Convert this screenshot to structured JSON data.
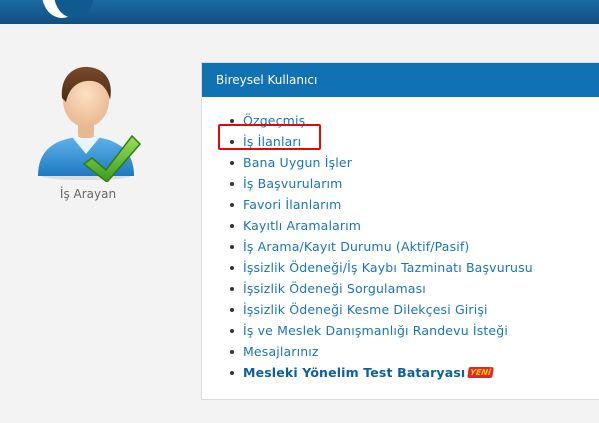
{
  "header": {
    "logo_icon": "site-logo-icon"
  },
  "profile": {
    "avatar_icon": "user-checkmark-icon",
    "label": "İş Arayan"
  },
  "panel": {
    "title": "Bireysel Kullanıcı",
    "items": [
      {
        "label": "Özgeçmiş"
      },
      {
        "label": "İş İlanları",
        "highlighted": true
      },
      {
        "label": "Bana Uygun İşler"
      },
      {
        "label": "İş Başvurularım"
      },
      {
        "label": "Favori İlanlarım"
      },
      {
        "label": "Kayıtlı Aramalarım"
      },
      {
        "label": "İş Arama/Kayıt Durumu (Aktif/Pasif)"
      },
      {
        "label": "İşsizlik Ödeneği/İş Kaybı Tazminatı Başvurusu"
      },
      {
        "label": "İşsizlik Ödeneği Sorgulaması"
      },
      {
        "label": "İşsizlik Ödeneği Kesme Dilekçesi Girişi"
      },
      {
        "label": "İş ve Meslek Danışmanlığı Randevu İsteği"
      },
      {
        "label": "Mesajlarınız"
      },
      {
        "label": "Mesleki Yönelim Test Bataryası",
        "bold": true,
        "badge": "YENİ"
      }
    ]
  },
  "colors": {
    "header_bg": "#1071b3",
    "link": "#1a74bc",
    "highlight_border": "#e00a0a",
    "badge_bg": "#e4232a"
  }
}
